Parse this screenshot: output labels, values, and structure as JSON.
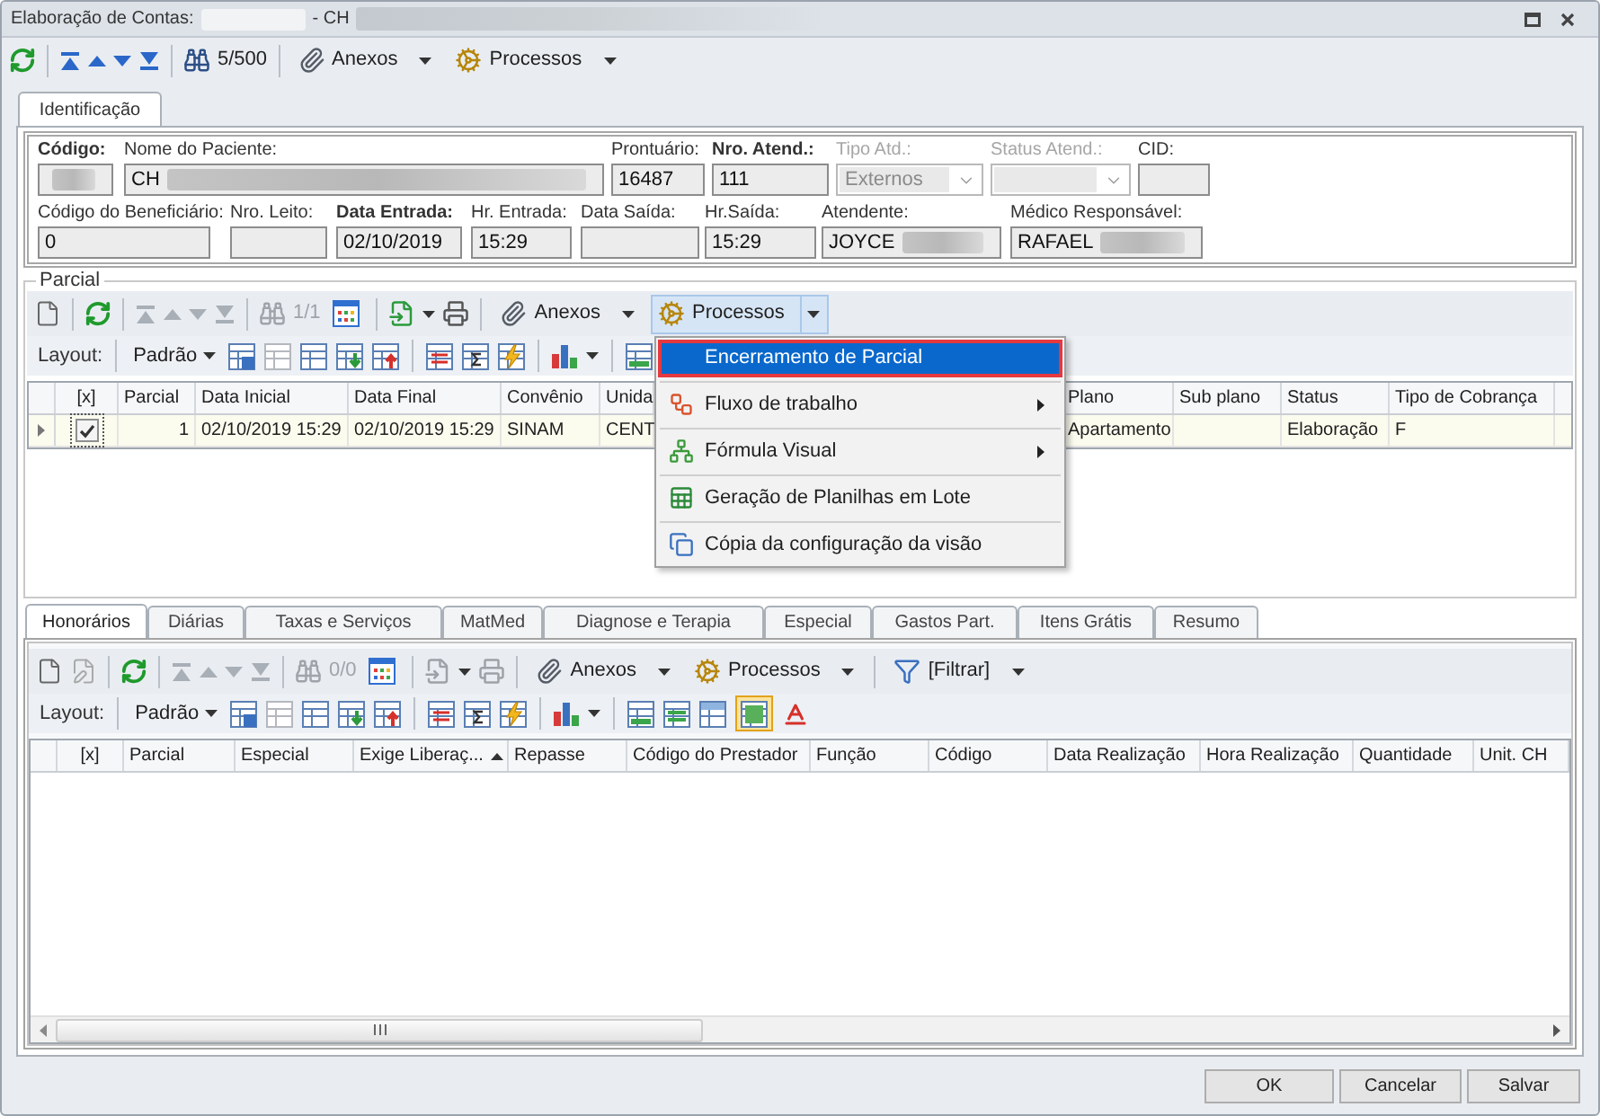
{
  "window": {
    "title": "Elaboração de Contas:",
    "title_redacted": true,
    "subtitle": "- CH",
    "subtitle_redacted": true
  },
  "toolbar": {
    "navigation_disabled": false,
    "counter": "5/500",
    "menus": [
      {
        "kind": "attachments",
        "label": "Anexos",
        "pressed": false
      },
      {
        "kind": "processes",
        "label": "Processos",
        "pressed": false
      }
    ]
  },
  "tabs": [
    {
      "label": "Identificação",
      "selected": true
    }
  ],
  "form": {
    "lines": [
      {
        "fields": [
          {
            "kind": "text",
            "label": "Código:",
            "emphasis": true,
            "disabled": false,
            "redacted": true
          },
          {
            "kind": "text",
            "label": "Nome do Paciente:",
            "value": "CH",
            "emphasis": false,
            "disabled": false,
            "redacted": true
          },
          {
            "kind": "text",
            "label": "Prontuário:",
            "value": "16487",
            "emphasis": false,
            "disabled": false,
            "redacted": false
          },
          {
            "kind": "text",
            "label": "Nro. Atend.:",
            "value": "111",
            "emphasis": true,
            "disabled": false,
            "redacted": false
          },
          {
            "kind": "dropdown",
            "label": "Tipo Atd.:",
            "value": "Externos",
            "emphasis": false,
            "disabled": true
          },
          {
            "kind": "dropdown",
            "label": "Status Atend.:",
            "emphasis": false,
            "disabled": true
          },
          {
            "kind": "text",
            "label": "CID:",
            "emphasis": false,
            "disabled": false,
            "redacted": false
          }
        ]
      },
      {
        "fields": [
          {
            "kind": "text",
            "label": "Código do Beneficiário:",
            "value": "0",
            "emphasis": false,
            "disabled": false,
            "redacted": false
          },
          {
            "kind": "text",
            "label": "Nro. Leito:",
            "emphasis": false,
            "disabled": false,
            "redacted": false
          },
          {
            "kind": "text",
            "label": "Data Entrada:",
            "value": "02/10/2019",
            "emphasis": true,
            "disabled": false,
            "redacted": false
          },
          {
            "kind": "text",
            "label": "Hr. Entrada:",
            "value": "15:29",
            "emphasis": false,
            "disabled": false,
            "redacted": false
          },
          {
            "kind": "text",
            "label": "Data Saída:",
            "emphasis": false,
            "disabled": false,
            "redacted": false
          },
          {
            "kind": "text",
            "label": "Hr.Saída:",
            "value": "15:29",
            "emphasis": false,
            "disabled": false,
            "redacted": false
          },
          {
            "kind": "text",
            "label": "Atendente:",
            "value": "JOYCE",
            "emphasis": false,
            "disabled": false,
            "redacted": true
          },
          {
            "kind": "text",
            "label": "Médico Responsável:",
            "value": "RAFAEL",
            "emphasis": false,
            "disabled": false,
            "redacted": true
          }
        ]
      }
    ]
  },
  "parcial": {
    "title": "Parcial",
    "toolbar": {
      "navigation_disabled": true,
      "output_disabled": false,
      "counter": "1/1",
      "menus": [
        {
          "kind": "attachments",
          "label": "Anexos",
          "pressed": false
        },
        {
          "kind": "processes",
          "label": "Processos",
          "pressed": true
        }
      ]
    },
    "layout": {
      "label": "Layout:",
      "preset": "Padrão"
    },
    "menu": {
      "items": [
        {
          "label": "Encerramento de Parcial",
          "selected": true,
          "submenu": false
        },
        {
          "label": "Fluxo de trabalho",
          "selected": false,
          "submenu": true
        },
        {
          "label": "Fórmula Visual",
          "selected": false,
          "submenu": true
        },
        {
          "label": "Geração de Planilhas em Lote",
          "selected": false,
          "submenu": false
        },
        {
          "label": "Cópia da configuração da visão",
          "selected": false,
          "submenu": false
        }
      ]
    },
    "table": {
      "columns": [
        "[x]",
        "Parcial",
        "Data Inicial",
        "Data Final",
        "Convênio",
        "Unida",
        "Plano",
        "Sub plano",
        "Status",
        "Tipo de Cobrança"
      ],
      "rows": [
        {
          "selected": true,
          "checked": true,
          "cells": [
            "",
            "1",
            "02/10/2019 15:29",
            "02/10/2019 15:29",
            "SINAM",
            "CENT",
            "Apartamento",
            "",
            "Elaboração",
            "F"
          ]
        }
      ]
    }
  },
  "detail_tabs": [
    {
      "label": "Honorários",
      "selected": true
    },
    {
      "label": "Diárias",
      "selected": false
    },
    {
      "label": "Taxas e Serviços",
      "selected": false
    },
    {
      "label": "MatMed",
      "selected": false
    },
    {
      "label": "Diagnose e Terapia",
      "selected": false
    },
    {
      "label": "Especial",
      "selected": false
    },
    {
      "label": "Gastos Part.",
      "selected": false
    },
    {
      "label": "Itens Grátis",
      "selected": false
    },
    {
      "label": "Resumo",
      "selected": false
    }
  ],
  "detail": {
    "toolbar": {
      "navigation_disabled": true,
      "output_disabled": true,
      "counter": "0/0",
      "menus": [
        {
          "kind": "attachments",
          "label": "Anexos",
          "pressed": false
        },
        {
          "kind": "processes",
          "label": "Processos",
          "pressed": false
        },
        {
          "kind": "filter",
          "label": "[Filtrar]",
          "pressed": false
        }
      ]
    },
    "layout": {
      "label": "Layout:",
      "preset": "Padrão",
      "preview_checked": true
    },
    "table": {
      "columns": [
        {
          "label": "[x]",
          "sorted": false
        },
        {
          "label": "Parcial",
          "sorted": false
        },
        {
          "label": "Especial",
          "sorted": false
        },
        {
          "label": "Exige Liberaç...",
          "sorted": true
        },
        {
          "label": "Repasse",
          "sorted": false
        },
        {
          "label": "Código do Prestador",
          "sorted": false
        },
        {
          "label": "Função",
          "sorted": false
        },
        {
          "label": "Código",
          "sorted": false
        },
        {
          "label": "Data Realização",
          "sorted": false
        },
        {
          "label": "Hora Realização",
          "sorted": false
        },
        {
          "label": "Quantidade",
          "sorted": false
        },
        {
          "label": "Unit. CH",
          "sorted": false
        }
      ]
    }
  },
  "buttons": [
    {
      "label": "OK"
    },
    {
      "label": "Cancelar"
    },
    {
      "label": "Salvar"
    }
  ]
}
